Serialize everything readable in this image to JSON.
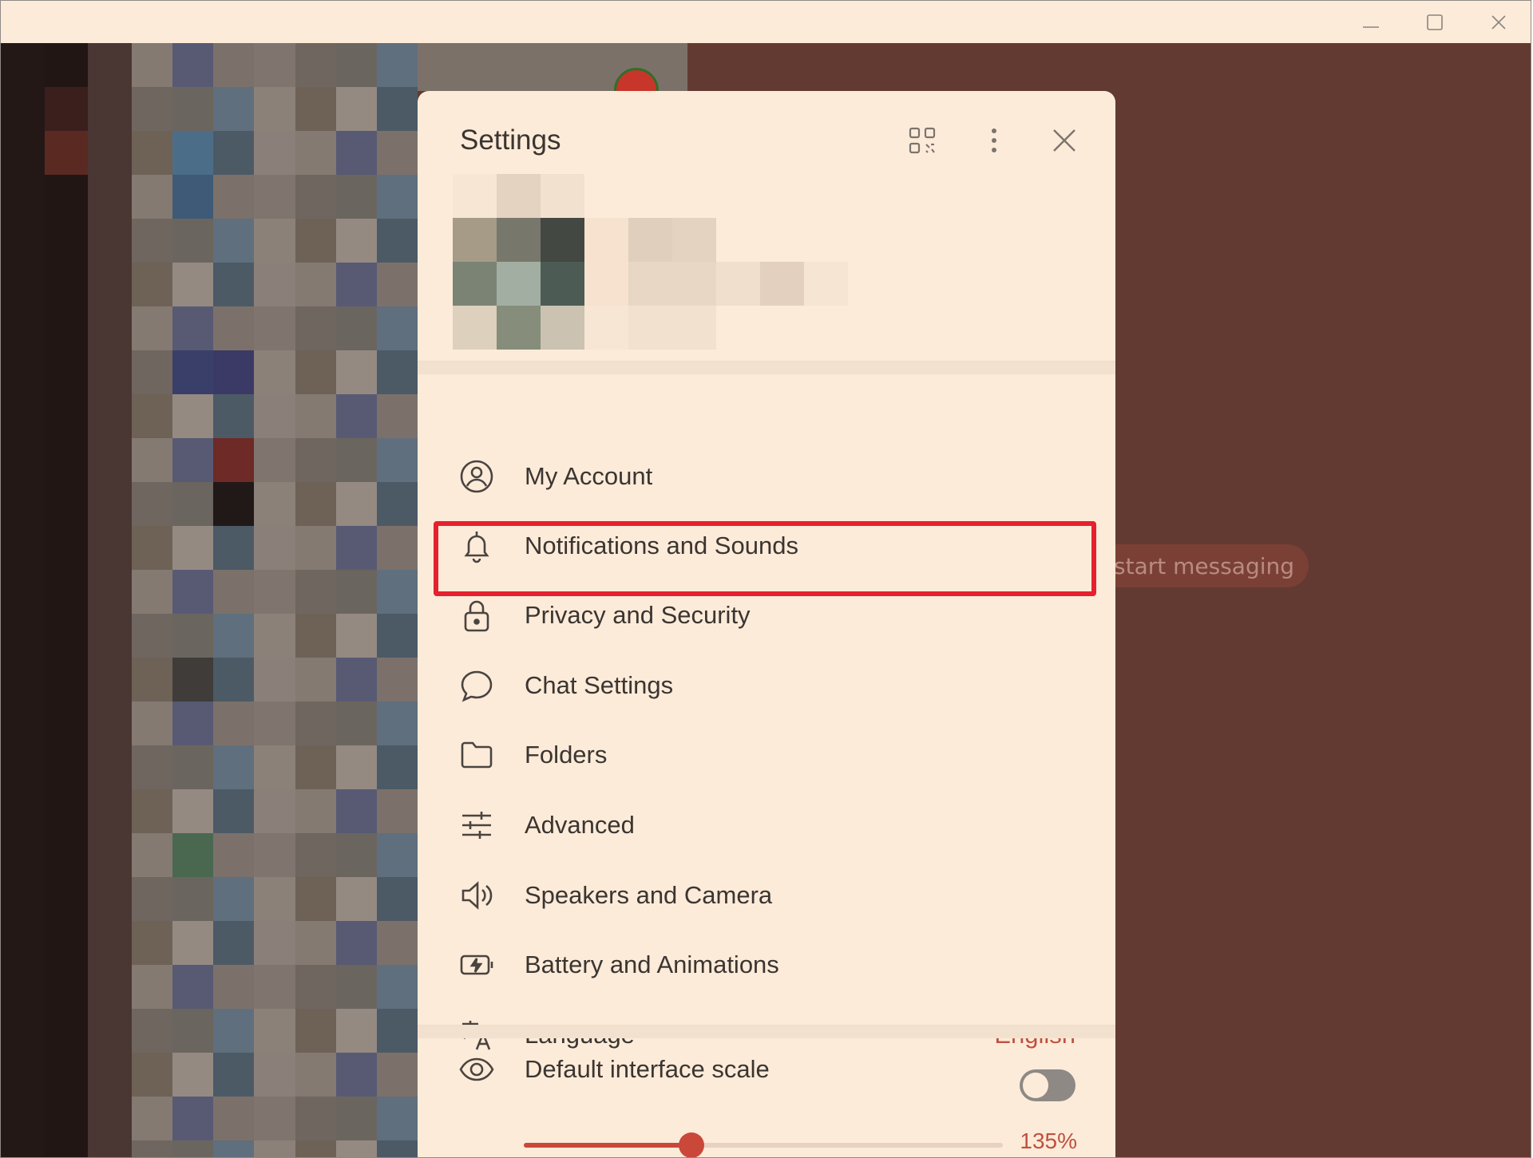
{
  "colors": {
    "accent": "#c9483a",
    "highlight_border": "#e5212f",
    "dialog_bg": "#fdebd9",
    "chat_bg": "#623a31"
  },
  "window_controls": [
    "minimize-icon",
    "maximize-icon",
    "close-icon"
  ],
  "background": {
    "start_messaging_pill": "start messaging"
  },
  "dialog": {
    "title": "Settings",
    "header_icons": [
      "qr-code-icon",
      "more-vertical-icon",
      "close-icon"
    ],
    "menu": [
      {
        "label": "My Account",
        "icon": "account-circle-icon"
      },
      {
        "label": "Notifications and Sounds",
        "icon": "bell-icon"
      },
      {
        "label": "Privacy and Security",
        "icon": "lock-icon",
        "highlighted": true
      },
      {
        "label": "Chat Settings",
        "icon": "chat-bubble-icon"
      },
      {
        "label": "Folders",
        "icon": "folder-icon"
      },
      {
        "label": "Advanced",
        "icon": "sliders-icon"
      },
      {
        "label": "Speakers and Camera",
        "icon": "speaker-icon"
      },
      {
        "label": "Battery and Animations",
        "icon": "battery-icon"
      },
      {
        "label": "Language",
        "icon": "translate-icon",
        "value": "English"
      }
    ],
    "scale": {
      "label": "Default interface scale",
      "icon": "eye-icon",
      "toggle_on": false,
      "slider_fraction": 0.35,
      "value": "135%"
    }
  }
}
